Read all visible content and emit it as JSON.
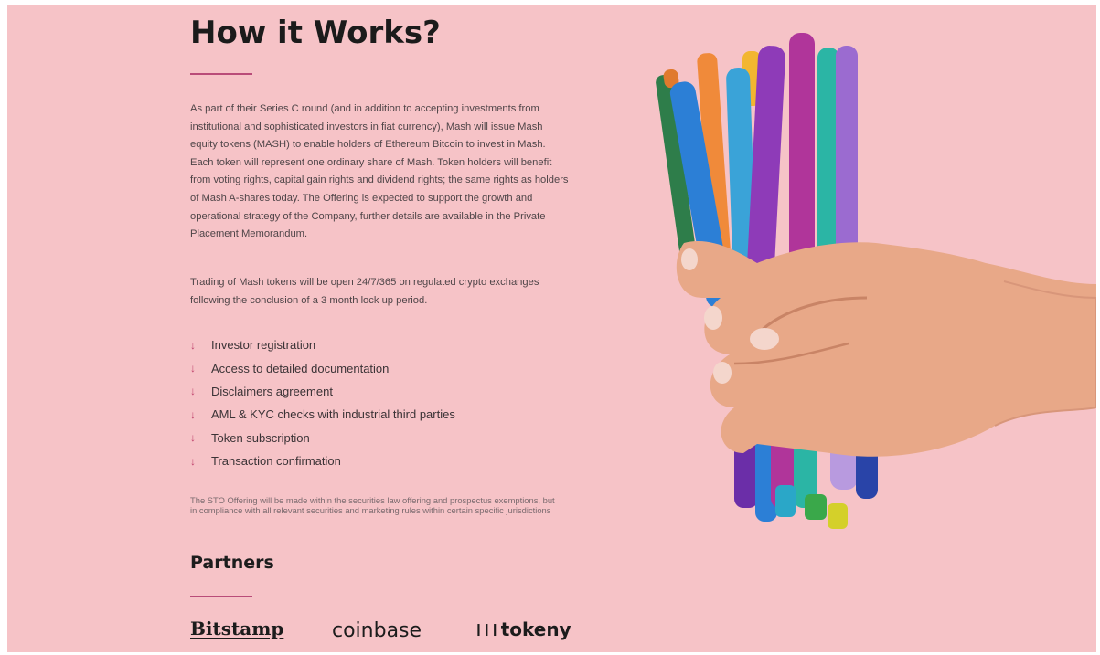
{
  "section": {
    "title": "How it Works?",
    "paragraphs": [
      "As part of their Series C round (and in addition to accepting investments from institutional and sophisticated investors in fiat currency), Mash will issue Mash equity tokens (MASH) to enable holders of Ethereum Bitcoin to invest in Mash. Each token will represent one ordinary share of Mash. Token holders will benefit from voting rights, capital gain rights and dividend rights; the same rights as holders of Mash A-shares today. The Offering is expected to support the growth and operational strategy of the Company, further details are available in the Private Placement Memorandum.",
      "Trading of Mash tokens will be open 24/7/365 on regulated crypto exchanges following the conclusion of a 3 month lock up period."
    ],
    "step_arrow": "↓",
    "steps": [
      "Investor registration",
      "Access to detailed documentation",
      "Disclaimers agreement",
      "AML & KYC checks with industrial third parties",
      "Token subscription",
      "Transaction confirmation"
    ],
    "disclaimer": "The STO Offering will be made within the securities law offering and prospectus exemptions, but in compliance with all relevant securities and marketing rules within certain specific jurisdictions"
  },
  "partners": {
    "title": "Partners",
    "logos": [
      "Bitstamp",
      "coinbase",
      "tokeny"
    ]
  },
  "colors": {
    "background": "#f6c3c7",
    "accent": "#b94c79",
    "text": "#4f4548"
  },
  "image": {
    "description_icon": "hand-holding-pens-photo"
  }
}
